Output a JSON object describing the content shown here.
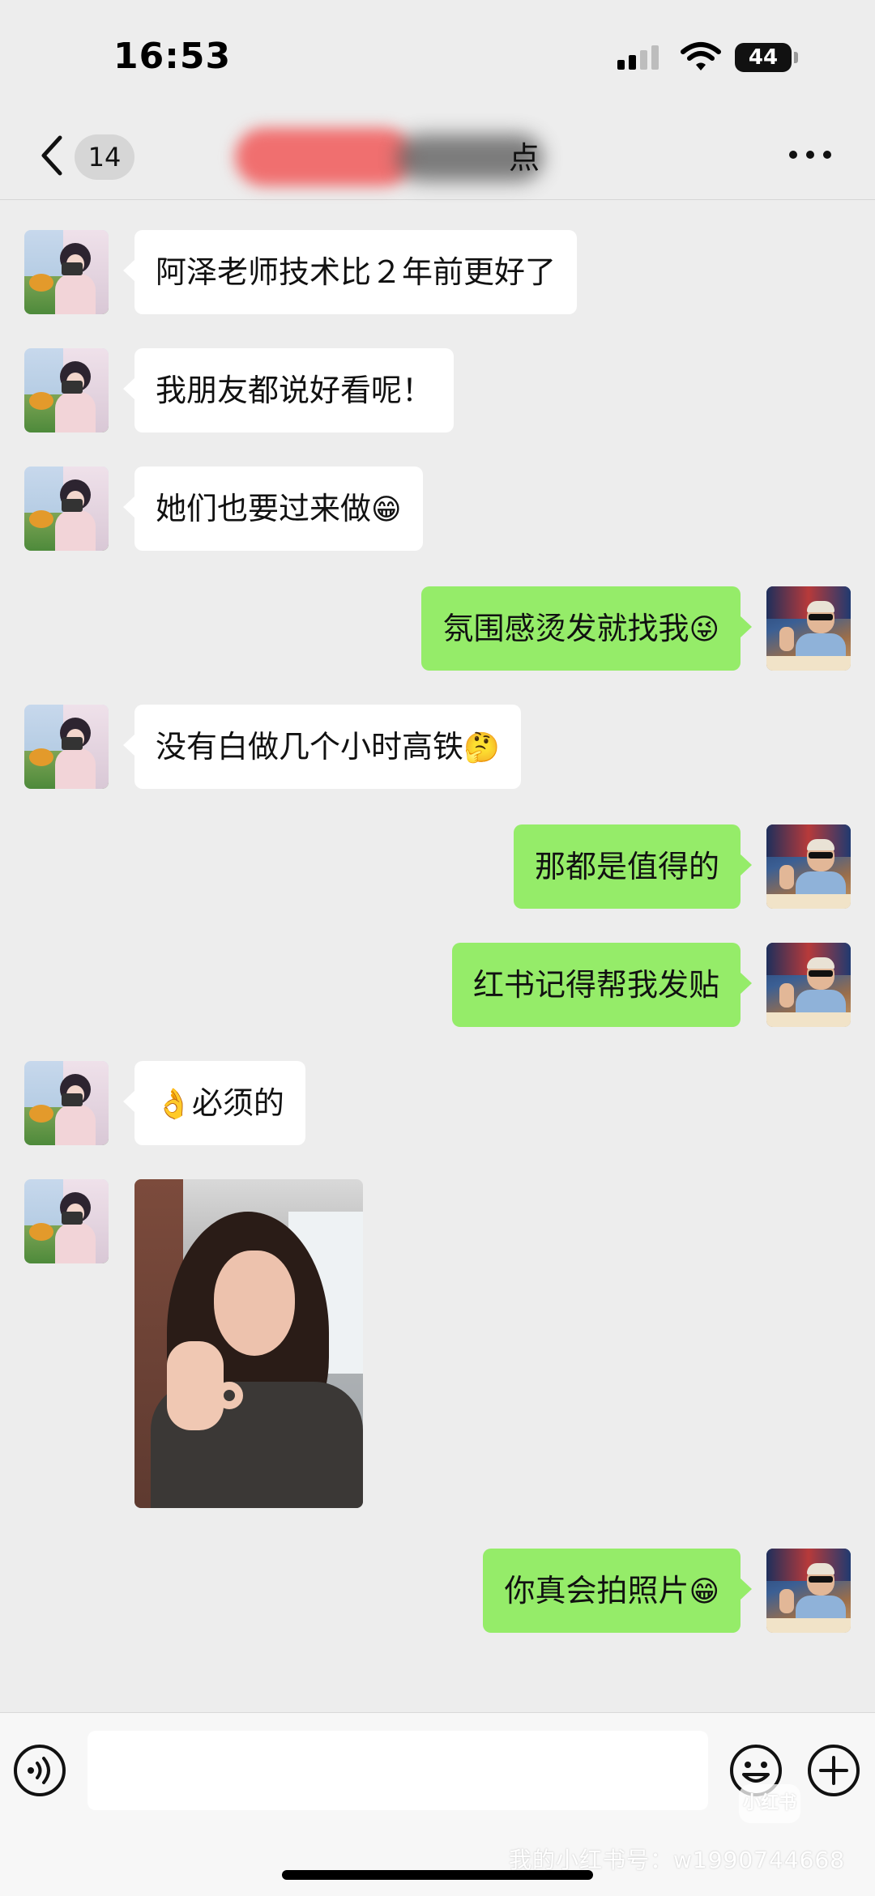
{
  "status_bar": {
    "time": "16:53",
    "battery": "44"
  },
  "header": {
    "back_count": "14",
    "title_visible_suffix": "点"
  },
  "colors": {
    "background": "#ededed",
    "incoming_bubble": "#ffffff",
    "outgoing_bubble": "#95ec69"
  },
  "messages": [
    {
      "direction": "in",
      "text": "阿泽老师技术比２年前更好了",
      "emoji": "",
      "avatar": "contact-avatar"
    },
    {
      "direction": "in",
      "text": "我朋友都说好看呢！",
      "emoji": "",
      "avatar": "contact-avatar"
    },
    {
      "direction": "in",
      "text": "她们也要过来做",
      "emoji": "😁",
      "avatar": "contact-avatar"
    },
    {
      "direction": "out",
      "text": "氛围感烫发就找我",
      "emoji": "😜",
      "avatar": "my-avatar"
    },
    {
      "direction": "in",
      "text": "没有白做几个小时高铁",
      "emoji": "🤔",
      "avatar": "contact-avatar"
    },
    {
      "direction": "out",
      "text": "那都是值得的",
      "emoji": "",
      "avatar": "my-avatar"
    },
    {
      "direction": "out",
      "text": "红书记得帮我发贴",
      "emoji": "",
      "avatar": "my-avatar"
    },
    {
      "direction": "in",
      "text": "必须的",
      "emoji": "👌",
      "avatar": "contact-avatar"
    },
    {
      "direction": "in",
      "type": "image",
      "image": "selfie-photo",
      "avatar": "contact-avatar"
    },
    {
      "direction": "out",
      "text": "你真会拍照片",
      "emoji": "😁",
      "avatar": "my-avatar"
    }
  ],
  "input_bar": {
    "placeholder": "",
    "icons": [
      "voice-icon",
      "emoji-face-icon",
      "plus-circle-icon"
    ]
  },
  "watermark": {
    "logo": "小红书",
    "text": "我的小红书号：w1990744668"
  }
}
